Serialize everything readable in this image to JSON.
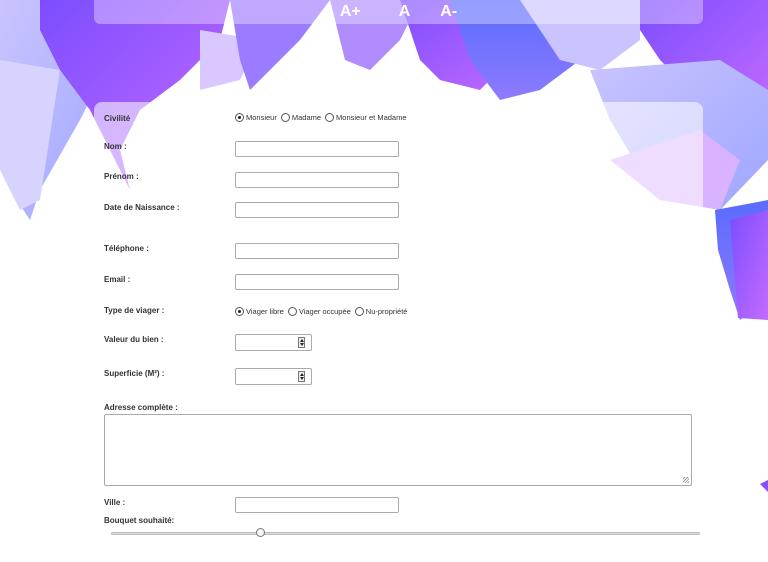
{
  "zoom_controls": {
    "increase": "A+",
    "reset": "A",
    "decrease": "A-"
  },
  "form": {
    "civilite": {
      "label": "Civilité",
      "options": [
        "Monsieur",
        "Madame",
        "Monsieur et Madame"
      ],
      "selected": "Monsieur"
    },
    "nom": {
      "label": "Nom :",
      "value": ""
    },
    "prenom": {
      "label": "Prénom :",
      "value": ""
    },
    "naissance": {
      "label": "Date de Naissance :",
      "value": ""
    },
    "telephone": {
      "label": "Téléphone :",
      "value": ""
    },
    "email": {
      "label": "Email :",
      "value": ""
    },
    "type_viager": {
      "label": "Type de viager :",
      "options": [
        "Viager libre",
        "Viager occupée",
        "Nu-propriété"
      ],
      "selected": "Viager libre"
    },
    "valeur": {
      "label": "Valeur du bien :",
      "value": ""
    },
    "superficie": {
      "label": "Superficie (M²) :",
      "value": ""
    },
    "adresse": {
      "label": "Adresse complète :",
      "value": ""
    },
    "ville": {
      "label": "Ville :",
      "value": ""
    },
    "bouquet": {
      "label": "Bouquet souhaité:",
      "level_fraction": 0.25
    }
  },
  "colors": {
    "leaf_purple": "#8a4dff",
    "leaf_lavender": "#b9b3ff",
    "leaf_blue": "#6b73ff"
  }
}
